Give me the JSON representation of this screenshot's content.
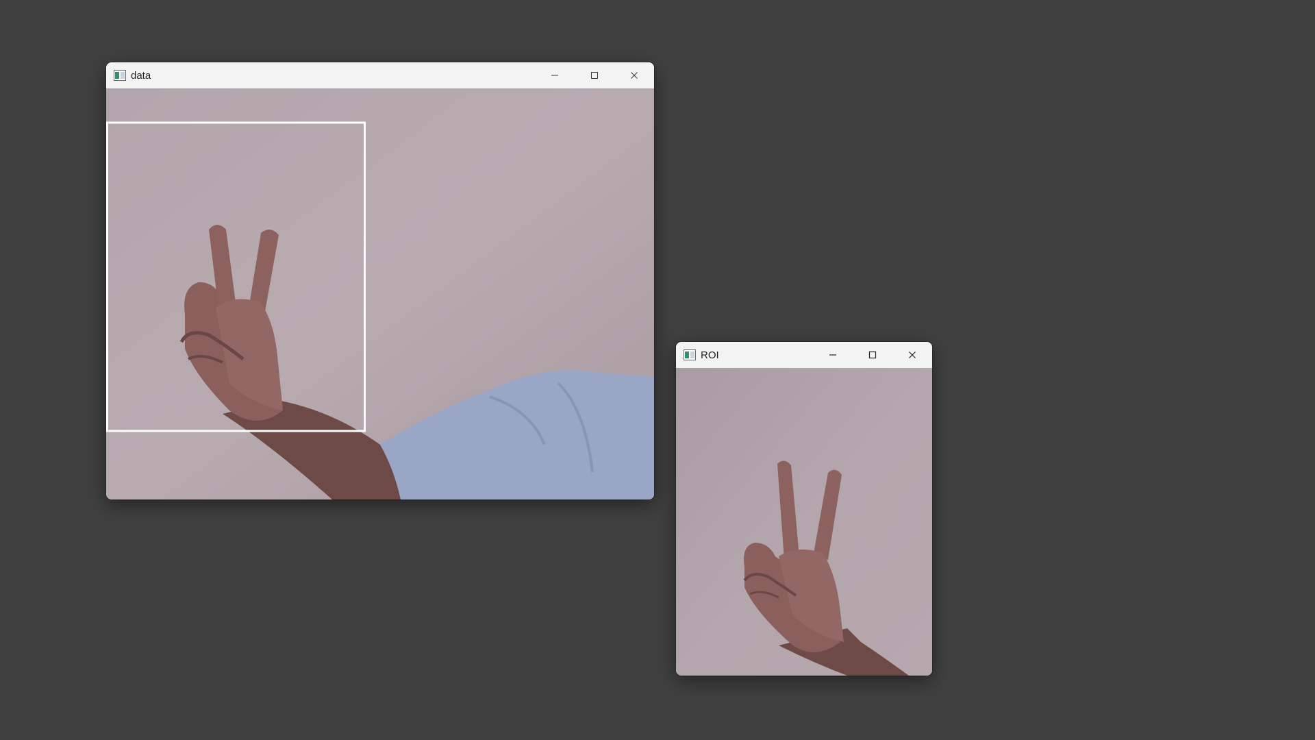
{
  "desktop": {
    "background": "#404040"
  },
  "windows": {
    "data": {
      "title": "data",
      "icon": "opencv-window-icon"
    },
    "roi": {
      "title": "ROI",
      "icon": "opencv-window-icon"
    }
  },
  "colors": {
    "wall_light": "#b6a7ad",
    "wall_dark": "#a59aa0",
    "skin": "#8a5f5c",
    "skin_dark": "#5f3f3c",
    "shirt": "#9aa6c8",
    "roi_box": "#ffffff"
  }
}
